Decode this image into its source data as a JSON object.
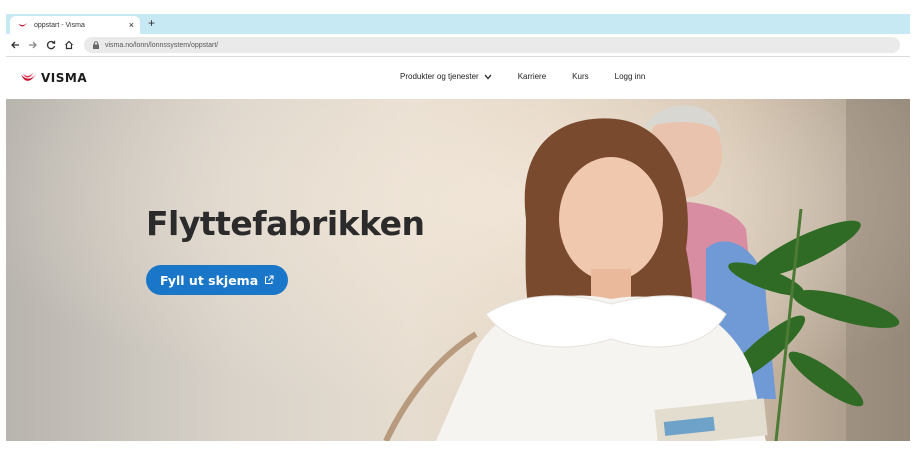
{
  "browser": {
    "tab_title": "oppstart - Visma",
    "tab_close": "×",
    "new_tab": "+",
    "url": "visma.no/lonn/lonnssystem/oppstart/"
  },
  "header": {
    "logo_text": "VISMA",
    "brand_color": "#c8102e",
    "nav": [
      {
        "label": "Produkter og tjenester",
        "icon": "chevron-down-icon"
      },
      {
        "label": "Karriere"
      },
      {
        "label": "Kurs"
      },
      {
        "label": "Logg inn"
      }
    ]
  },
  "hero": {
    "title": "Flyttefabrikken",
    "cta_label": "Fyll ut skjema",
    "cta_icon": "external-link-icon",
    "cta_color": "#1976c9",
    "image_label": "hero-photo"
  }
}
